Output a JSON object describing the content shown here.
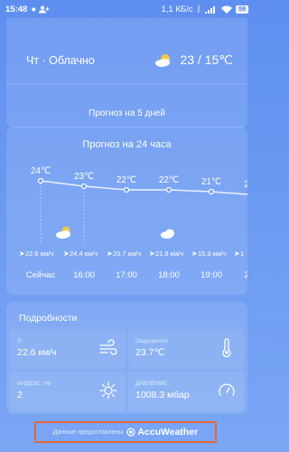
{
  "status_bar": {
    "time": "15:48",
    "network_speed": "1,1 КБ/с",
    "battery": "59"
  },
  "today": {
    "day_condition": "Чт · Облачно",
    "temps": "23 / 15℃",
    "icon": "partly-cloudy-icon"
  },
  "forecast_5_days_label": "Прогноз на 5 дней",
  "hourly": {
    "title": "Прогноз на 24 часа",
    "temps": [
      "24℃",
      "23℃",
      "22℃",
      "22℃",
      "21℃",
      "2"
    ],
    "winds": [
      "22.6 км/ч",
      "24.4 км/ч",
      "20.7 км/ч",
      "21.8 км/ч",
      "15.3 км/ч",
      "1"
    ],
    "times": [
      "Сейчас",
      "16:00",
      "17:00",
      "18:00",
      "19:00",
      "2"
    ],
    "icons": [
      "partly-cloudy-icon",
      "cloud-icon"
    ]
  },
  "details": {
    "title": "Подробности",
    "wind_label": "З",
    "wind_value": "22.6 км/ч",
    "feels_label": "Ощущается",
    "feels_value": "23.7℃",
    "uv_label": "ИНДЕКС УФ",
    "uv_value": "2",
    "pressure_label": "ДАВЛЕНИЕ",
    "pressure_value": "1008.3 мбар"
  },
  "footer": {
    "provided_by": "Данные предоставлены",
    "brand": "AccuWeather"
  },
  "colors": {
    "background": "#6b9af2",
    "highlight_border": "#e2663f",
    "sun": "#f6c84a"
  }
}
